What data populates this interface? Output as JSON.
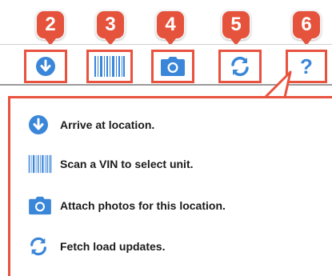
{
  "callouts": [
    "2",
    "3",
    "4",
    "5",
    "6"
  ],
  "toolbar": {
    "arrive_icon": "arrow-down-circle-icon",
    "scan_icon": "barcode-icon",
    "photo_icon": "camera-icon",
    "refresh_icon": "refresh-icon",
    "help_icon": "question-mark-icon",
    "help_label": "?"
  },
  "help_panel": {
    "items": [
      {
        "icon": "arrow-down-circle-icon",
        "label": "Arrive at location."
      },
      {
        "icon": "barcode-icon",
        "label": "Scan a VIN to select unit."
      },
      {
        "icon": "camera-icon",
        "label": "Attach photos for this location."
      },
      {
        "icon": "refresh-icon",
        "label": "Fetch load updates."
      }
    ]
  },
  "colors": {
    "callout_red": "#e5533d",
    "icon_blue": "#3a86d8",
    "highlight_border": "#e8533f"
  }
}
